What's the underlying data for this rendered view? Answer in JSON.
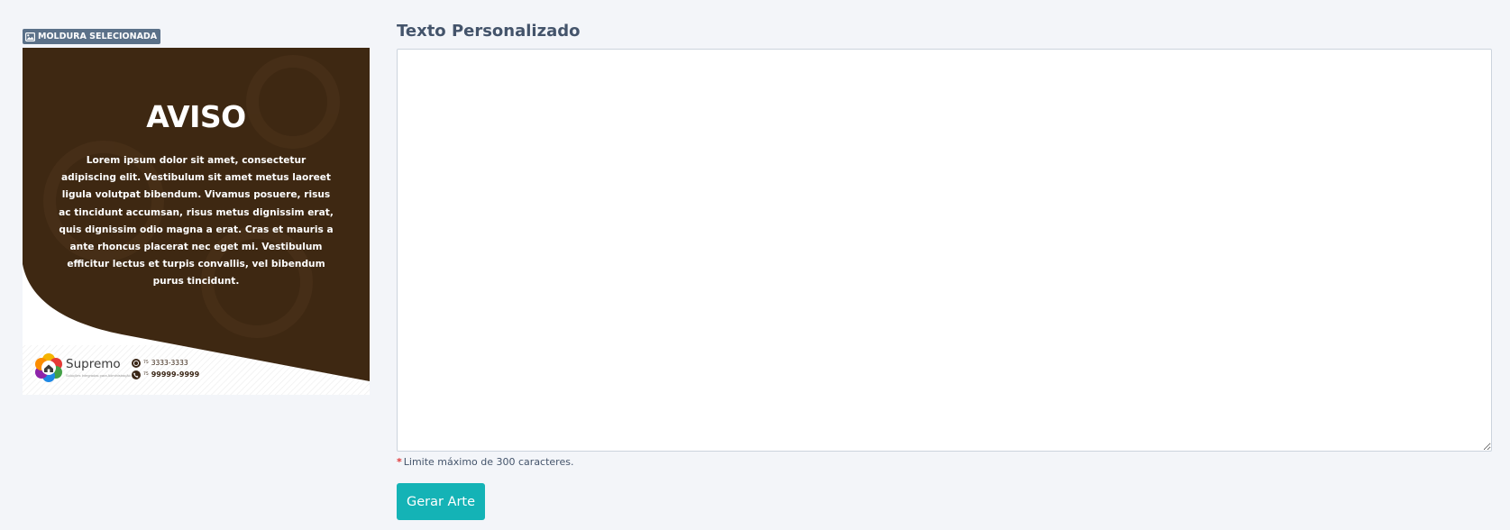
{
  "badge": {
    "label": "MOLDURA SELECIONADA",
    "icon": "image-icon"
  },
  "preview": {
    "title": "AVISO",
    "body": "Lorem ipsum dolor sit amet, consectetur adipiscing elit. Vestibulum sit amet metus laoreet ligula volutpat bibendum. Vivamus posuere, risus ac tincidunt accumsan, risus metus dignissim erat, quis dignissim odio magna a erat. Cras et mauris a ante rhoncus placerat nec eget mi. Vestibulum efficitur lectus et turpis convallis, vel bibendum purus tincidunt.",
    "brand_name": "Supremo",
    "brand_tagline": "Soluções Integradas para Administração",
    "contacts": [
      {
        "icon": "whatsapp-icon",
        "ddd": "75",
        "number": "3333-3333"
      },
      {
        "icon": "phone-icon",
        "ddd": "75",
        "number": "99999-9999"
      }
    ],
    "colors": {
      "brown": "#3e2812",
      "white": "#ffffff"
    }
  },
  "form": {
    "label": "Texto Personalizado",
    "value": "",
    "required_mark": "*",
    "hint": "Limite máximo de 300 caracteres.",
    "button": "Gerar Arte"
  },
  "colors": {
    "accent": "#14b3b6",
    "badge": "#5b7189",
    "label": "#44546b",
    "required": "#e03a3a"
  }
}
